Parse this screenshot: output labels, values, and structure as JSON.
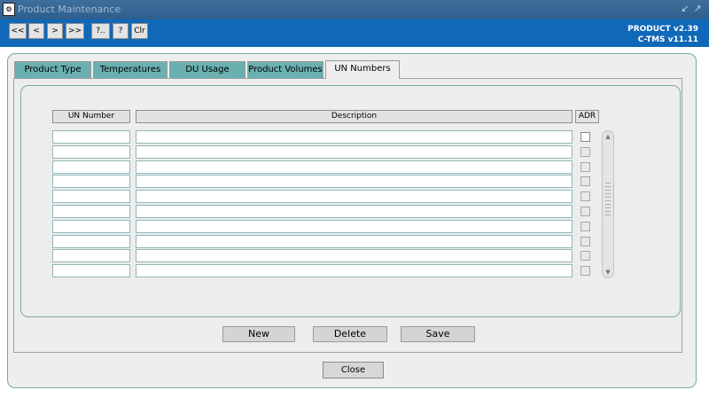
{
  "window": {
    "title": "Product Maintenance",
    "app_icon": "oracle-forms-icon",
    "controls": [
      "restore-icon",
      "maximize-icon"
    ]
  },
  "toolbar": {
    "buttons": [
      {
        "label": "<<",
        "name": "first-record-button"
      },
      {
        "label": "<",
        "name": "previous-record-button"
      },
      {
        "label": ">",
        "name": "next-record-button"
      },
      {
        "label": ">>",
        "name": "last-record-button"
      },
      {
        "label": "?..",
        "name": "list-values-button"
      },
      {
        "label": "?",
        "name": "help-button"
      },
      {
        "label": "Clr",
        "name": "clear-button"
      }
    ],
    "version_line1": "PRODUCT v2.39",
    "version_line2": "C-TMS v11.11"
  },
  "tabs": [
    {
      "label": "Product Type",
      "active": false
    },
    {
      "label": "Temperatures",
      "active": false
    },
    {
      "label": "DU Usage",
      "active": false
    },
    {
      "label": "Product Volumes",
      "active": false
    },
    {
      "label": "UN Numbers",
      "active": true
    }
  ],
  "grid": {
    "columns": [
      "UN Number",
      "Description",
      "ADR"
    ],
    "rows": [
      {
        "un_number": "",
        "description": "",
        "adr": false
      },
      {
        "un_number": "",
        "description": "",
        "adr": false
      },
      {
        "un_number": "",
        "description": "",
        "adr": false
      },
      {
        "un_number": "",
        "description": "",
        "adr": false
      },
      {
        "un_number": "",
        "description": "",
        "adr": false
      },
      {
        "un_number": "",
        "description": "",
        "adr": false
      },
      {
        "un_number": "",
        "description": "",
        "adr": false
      },
      {
        "un_number": "",
        "description": "",
        "adr": false
      },
      {
        "un_number": "",
        "description": "",
        "adr": false
      },
      {
        "un_number": "",
        "description": "",
        "adr": false
      }
    ]
  },
  "actions": {
    "new": "New",
    "delete": "Delete",
    "save": "Save",
    "close": "Close"
  },
  "colors": {
    "titlebar": "#2d5f8f",
    "toolbar": "#0f68b8",
    "tab_inactive": "#6ab0b0",
    "panel_border": "#79a9a9",
    "background": "#eeeeee"
  }
}
